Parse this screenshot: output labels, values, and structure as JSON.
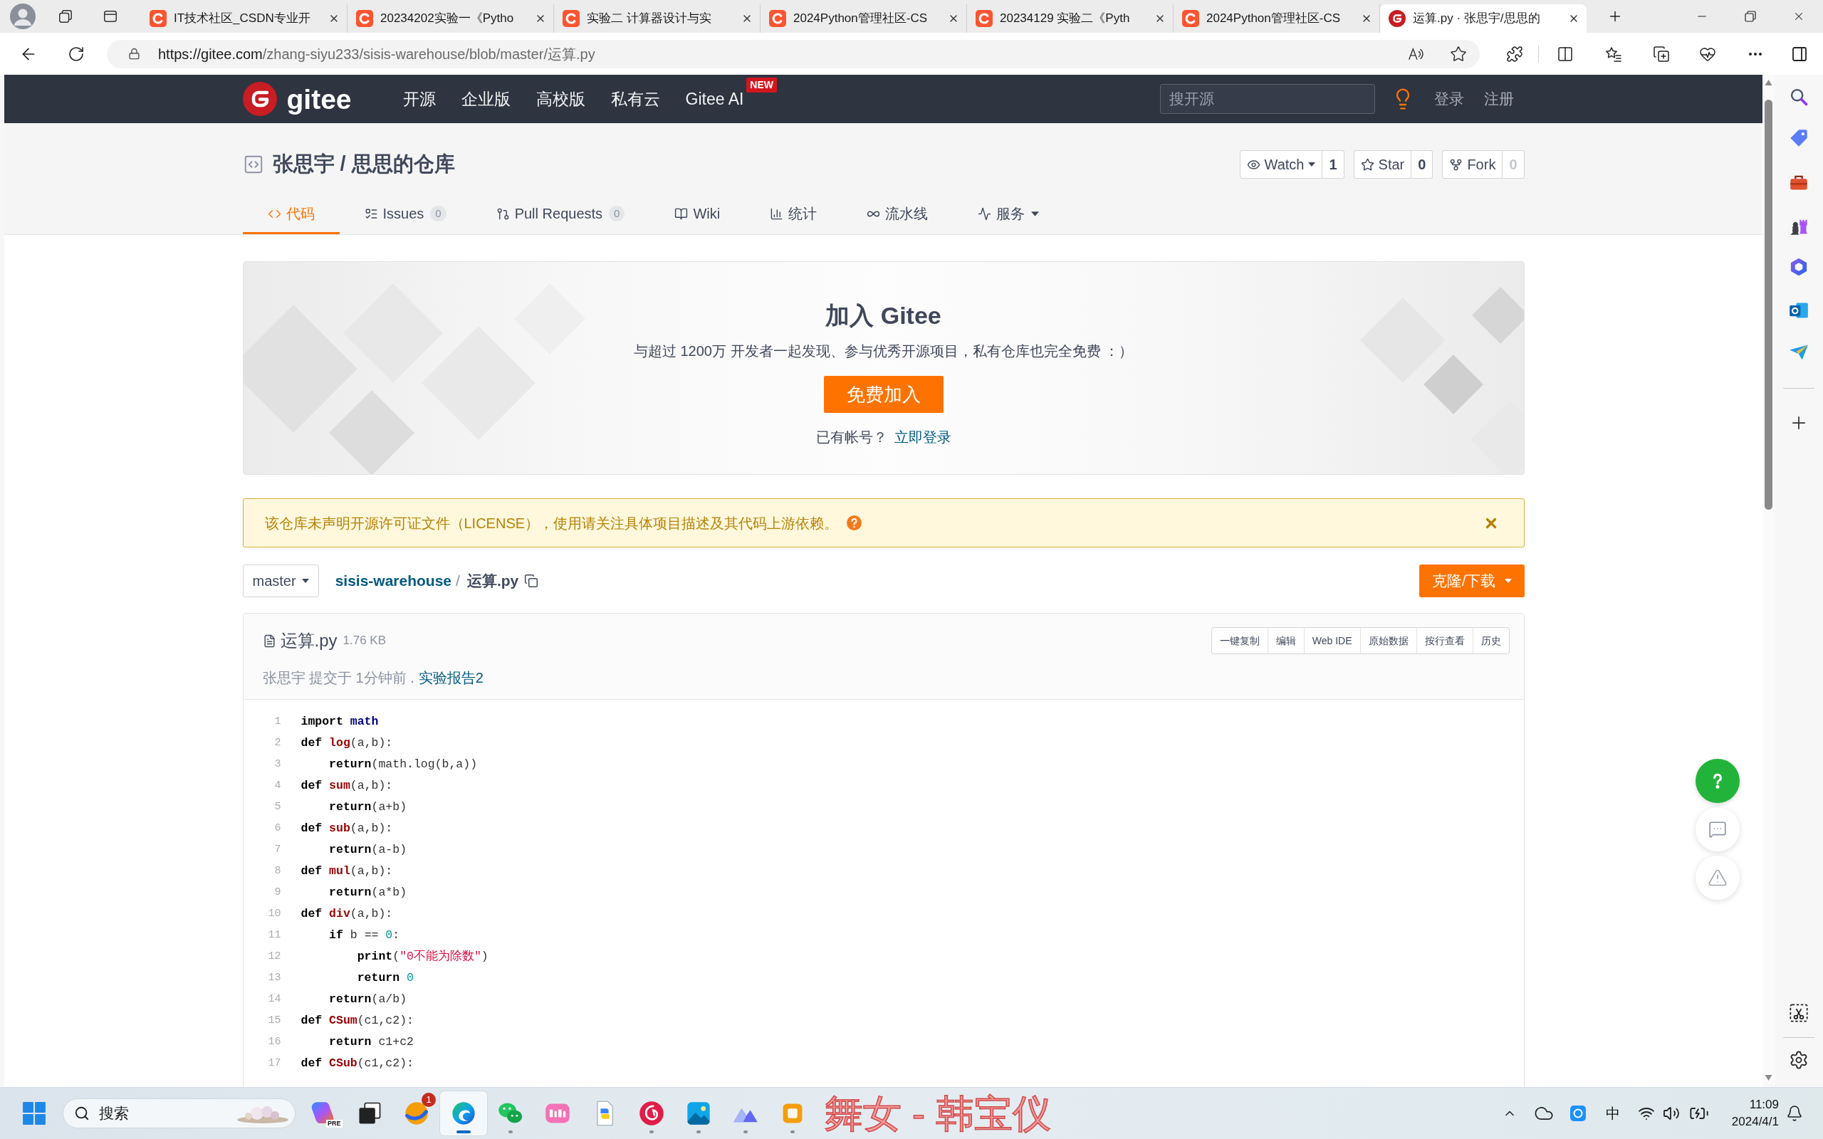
{
  "browser": {
    "tabs": [
      {
        "kind": "csdn",
        "title": "IT技术社区_CSDN专业开",
        "selected": false
      },
      {
        "kind": "csdn",
        "title": "20234202实验一《Pytho",
        "selected": false
      },
      {
        "kind": "csdn",
        "title": "实验二 计算器设计与实",
        "selected": false
      },
      {
        "kind": "csdn",
        "title": "2024Python管理社区-CS",
        "selected": false
      },
      {
        "kind": "csdn",
        "title": "20234129 实验二《Pyth",
        "selected": false
      },
      {
        "kind": "csdn",
        "title": "2024Python管理社区-CS",
        "selected": false
      },
      {
        "kind": "gitee",
        "title": "运算.py · 张思宇/思思的",
        "selected": true
      }
    ],
    "address": {
      "origin": "https://gitee.com",
      "path": "/zhang-siyu233/sisis-warehouse/blob/master/运算.py"
    }
  },
  "site_header": {
    "logo": "gitee",
    "nav": [
      {
        "label": "开源"
      },
      {
        "label": "企业版"
      },
      {
        "label": "高校版"
      },
      {
        "label": "私有云"
      },
      {
        "label": "Gitee AI",
        "badge": "NEW"
      }
    ],
    "search": {
      "placeholder": "搜开源"
    },
    "links": [
      "登录",
      "注册"
    ]
  },
  "repo": {
    "title": "张思宇 / 思思的仓库",
    "actions": [
      {
        "kind": "watch",
        "label": "Watch",
        "count": "1",
        "muted": false
      },
      {
        "kind": "star",
        "label": "Star",
        "count": "0",
        "muted": false
      },
      {
        "kind": "fork",
        "label": "Fork",
        "count": "0",
        "muted": true
      }
    ],
    "tabs": [
      {
        "kind": "code",
        "label": "代码",
        "selected": true
      },
      {
        "kind": "issues",
        "label": "Issues",
        "count": "0",
        "selected": false
      },
      {
        "kind": "pulls",
        "label": "Pull Requests",
        "count": "0",
        "selected": false
      },
      {
        "kind": "wiki",
        "label": "Wiki",
        "selected": false
      },
      {
        "kind": "stats",
        "label": "统计",
        "selected": false
      },
      {
        "kind": "pipeline",
        "label": "流水线",
        "selected": false
      },
      {
        "kind": "services",
        "label": "服务",
        "selected": false
      }
    ]
  },
  "banner": {
    "title": "加入 Gitee",
    "subtitle": "与超过 1200万 开发者一起发现、参与优秀开源项目，私有仓库也完全免费 ：）",
    "button": "免费加入",
    "login_prompt": "已有帐号？",
    "login_link": "立即登录"
  },
  "notice": {
    "text": "该仓库未声明开源许可证文件（LICENSE），使用请关注具体项目描述及其代码上游依赖。"
  },
  "breadcrumb": {
    "branch": "master",
    "repo": "sisis-warehouse",
    "separator": "/",
    "file": "运算.py"
  },
  "clone_button": "克隆/下载",
  "file": {
    "name": "运算.py",
    "size": "1.76 KB",
    "actions": [
      "一键复制",
      "编辑",
      "Web IDE",
      "原始数据",
      "按行查看",
      "历史"
    ],
    "commit": {
      "text": "张思宇 提交于 1分钟前 .",
      "link": "实验报告2"
    },
    "lines": [
      {
        "number": "1",
        "tokens": [
          {
            "kind": "keyword",
            "text": "import "
          },
          {
            "kind": "module",
            "text": "math"
          }
        ]
      },
      {
        "number": "2",
        "tokens": [
          {
            "kind": "keyword",
            "text": "def "
          },
          {
            "kind": "function",
            "text": "log"
          },
          {
            "kind": "plain",
            "text": "(a,b):"
          }
        ]
      },
      {
        "number": "3",
        "tokens": [
          {
            "kind": "keyword",
            "text": "    return"
          },
          {
            "kind": "plain",
            "text": "(math.log(b,a))"
          }
        ]
      },
      {
        "number": "4",
        "tokens": [
          {
            "kind": "keyword",
            "text": "def "
          },
          {
            "kind": "function",
            "text": "sum"
          },
          {
            "kind": "plain",
            "text": "(a,b):"
          }
        ]
      },
      {
        "number": "5",
        "tokens": [
          {
            "kind": "keyword",
            "text": "    return"
          },
          {
            "kind": "plain",
            "text": "(a+b)"
          }
        ]
      },
      {
        "number": "6",
        "tokens": [
          {
            "kind": "keyword",
            "text": "def "
          },
          {
            "kind": "function",
            "text": "sub"
          },
          {
            "kind": "plain",
            "text": "(a,b):"
          }
        ]
      },
      {
        "number": "7",
        "tokens": [
          {
            "kind": "keyword",
            "text": "    return"
          },
          {
            "kind": "plain",
            "text": "(a-b)"
          }
        ]
      },
      {
        "number": "8",
        "tokens": [
          {
            "kind": "keyword",
            "text": "def "
          },
          {
            "kind": "function",
            "text": "mul"
          },
          {
            "kind": "plain",
            "text": "(a,b):"
          }
        ]
      },
      {
        "number": "9",
        "tokens": [
          {
            "kind": "keyword",
            "text": "    return"
          },
          {
            "kind": "plain",
            "text": "(a*b)"
          }
        ]
      },
      {
        "number": "10",
        "tokens": [
          {
            "kind": "keyword",
            "text": "def "
          },
          {
            "kind": "function",
            "text": "div"
          },
          {
            "kind": "plain",
            "text": "(a,b):"
          }
        ]
      },
      {
        "number": "11",
        "tokens": [
          {
            "kind": "keyword",
            "text": "    if"
          },
          {
            "kind": "plain",
            "text": " b == "
          },
          {
            "kind": "number",
            "text": "0"
          },
          {
            "kind": "plain",
            "text": ":"
          }
        ]
      },
      {
        "number": "12",
        "tokens": [
          {
            "kind": "keyword",
            "text": "        print"
          },
          {
            "kind": "plain",
            "text": "("
          },
          {
            "kind": "string",
            "text": "\"0不能为除数\""
          },
          {
            "kind": "plain",
            "text": ")"
          }
        ]
      },
      {
        "number": "13",
        "tokens": [
          {
            "kind": "keyword",
            "text": "        return "
          },
          {
            "kind": "number",
            "text": "0"
          }
        ]
      },
      {
        "number": "14",
        "tokens": [
          {
            "kind": "keyword",
            "text": "    return"
          },
          {
            "kind": "plain",
            "text": "(a/b)"
          }
        ]
      },
      {
        "number": "15",
        "tokens": [
          {
            "kind": "keyword",
            "text": "def "
          },
          {
            "kind": "function",
            "text": "CSum"
          },
          {
            "kind": "plain",
            "text": "(c1,c2):"
          }
        ]
      },
      {
        "number": "16",
        "tokens": [
          {
            "kind": "keyword",
            "text": "    return "
          },
          {
            "kind": "plain",
            "text": "c1+c2"
          }
        ]
      },
      {
        "number": "17",
        "tokens": [
          {
            "kind": "keyword",
            "text": "def "
          },
          {
            "kind": "function",
            "text": "CSub"
          },
          {
            "kind": "plain",
            "text": "(c1,c2):"
          }
        ]
      }
    ]
  },
  "taskbar": {
    "search": {
      "placeholder": "搜索"
    },
    "apps": [
      {
        "kind": "copilot",
        "label": "PRE",
        "running": false,
        "active": false
      },
      {
        "kind": "stack",
        "running": false,
        "active": false
      },
      {
        "kind": "orange",
        "badge": "1",
        "running": false,
        "active": false
      },
      {
        "kind": "browser",
        "running": true,
        "active": true
      },
      {
        "kind": "chat",
        "running": true,
        "active": false
      },
      {
        "kind": "pink",
        "running": false,
        "active": false
      },
      {
        "kind": "python",
        "running": false,
        "active": false
      },
      {
        "kind": "music",
        "running": true,
        "active": false
      },
      {
        "kind": "photos",
        "running": true,
        "active": false
      },
      {
        "kind": "mountain",
        "running": true,
        "active": false
      },
      {
        "kind": "misc",
        "running": true,
        "active": false
      }
    ],
    "lyrics": "舞女 - 韩宝仪",
    "ime": "中",
    "time": "11:09",
    "date": "2024/4/1"
  }
}
